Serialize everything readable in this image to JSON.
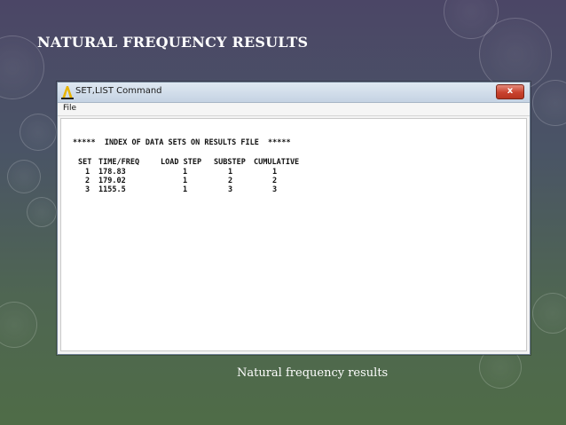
{
  "slide": {
    "title": "NATURAL FREQUENCY RESULTS",
    "caption": "Natural frequency results"
  },
  "window": {
    "title": "SET,LIST Command",
    "menu": [
      "File"
    ],
    "close_glyph": "x"
  },
  "output": {
    "header": "*****  INDEX OF DATA SETS ON RESULTS FILE  *****",
    "columns": [
      "SET",
      "TIME/FREQ",
      "LOAD STEP",
      "SUBSTEP",
      "CUMULATIVE"
    ],
    "rows": [
      [
        "1",
        "178.83",
        "1",
        "1",
        "1"
      ],
      [
        "2",
        "179.02",
        "1",
        "2",
        "2"
      ],
      [
        "3",
        "1155.5",
        "1",
        "3",
        "3"
      ]
    ]
  },
  "colors": {
    "title_text": "#ffffff",
    "window_frame": "#6f7f93",
    "close_button": "#c9432e",
    "app_icon": "#e8b400"
  },
  "icons": {
    "app": "ansys-a-icon",
    "close": "close-icon"
  }
}
